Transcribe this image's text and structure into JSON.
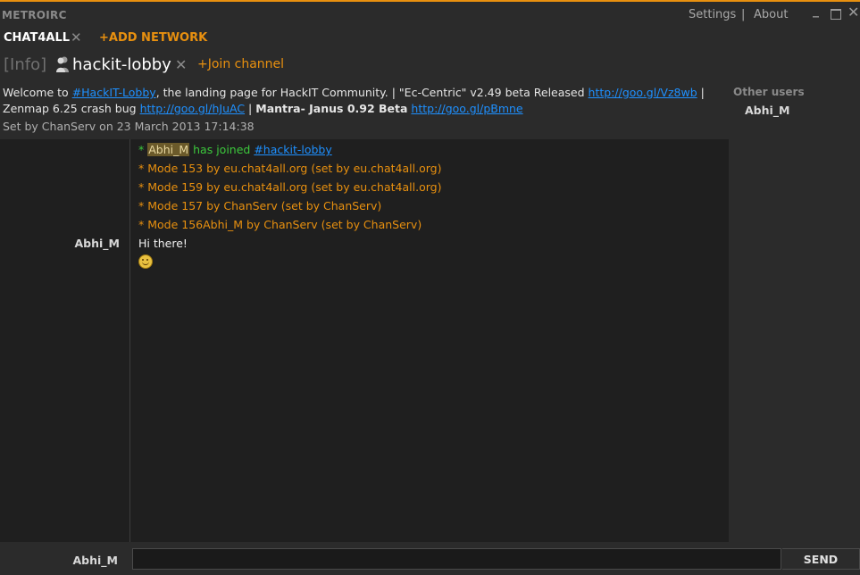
{
  "app": {
    "title": "METROIRC"
  },
  "menu": {
    "settings": "Settings",
    "separator": "|",
    "about": "About"
  },
  "network": {
    "name": "CHAT4ALL",
    "close": "✕",
    "add_label": "+ADD NETWORK"
  },
  "channels": {
    "info_tab": "[Info]",
    "active_tab": "hackit-lobby",
    "close": "✕",
    "join_label": "+Join channel"
  },
  "topic": {
    "parts": [
      "Welcome to ",
      "#HackIT-Lobby",
      ", the landing page for HackIT Community. | \"Ec-Centric\" v2.49 beta Released ",
      "http://goo.gl/Vz8wb",
      " | Zenmap 6.25 crash bug ",
      "http://goo.gl/hJuAC",
      " |  ",
      "Mantra- Janus 0.92 Beta",
      " ",
      "http://goo.gl/pBmne"
    ],
    "set_by": "Set by ChanServ on 23 March 2013 17:14:38"
  },
  "users": {
    "title": "Other users",
    "list": [
      "Abhi_M"
    ]
  },
  "messages": {
    "join_prefix": "* ",
    "join_nick": "Abhi_M",
    "join_text": " has joined ",
    "join_channel": "#hackit-lobby",
    "modes": [
      "* Mode 153 by eu.chat4all.org (set by eu.chat4all.org)",
      "* Mode 159 by eu.chat4all.org (set by eu.chat4all.org)",
      "* Mode 157 by ChanServ (set by ChanServ)",
      "* Mode 156Abhi_M by ChanServ (set by ChanServ)"
    ],
    "chat_nick": "Abhi_M",
    "chat_text": "Hi there!",
    "emoticon": "smiley-icon"
  },
  "input": {
    "nick": "Abhi_M",
    "value": "",
    "send_label": "SEND"
  },
  "colors": {
    "accent": "#e8900f",
    "link": "#1e90ff",
    "join": "#3cc83c"
  }
}
